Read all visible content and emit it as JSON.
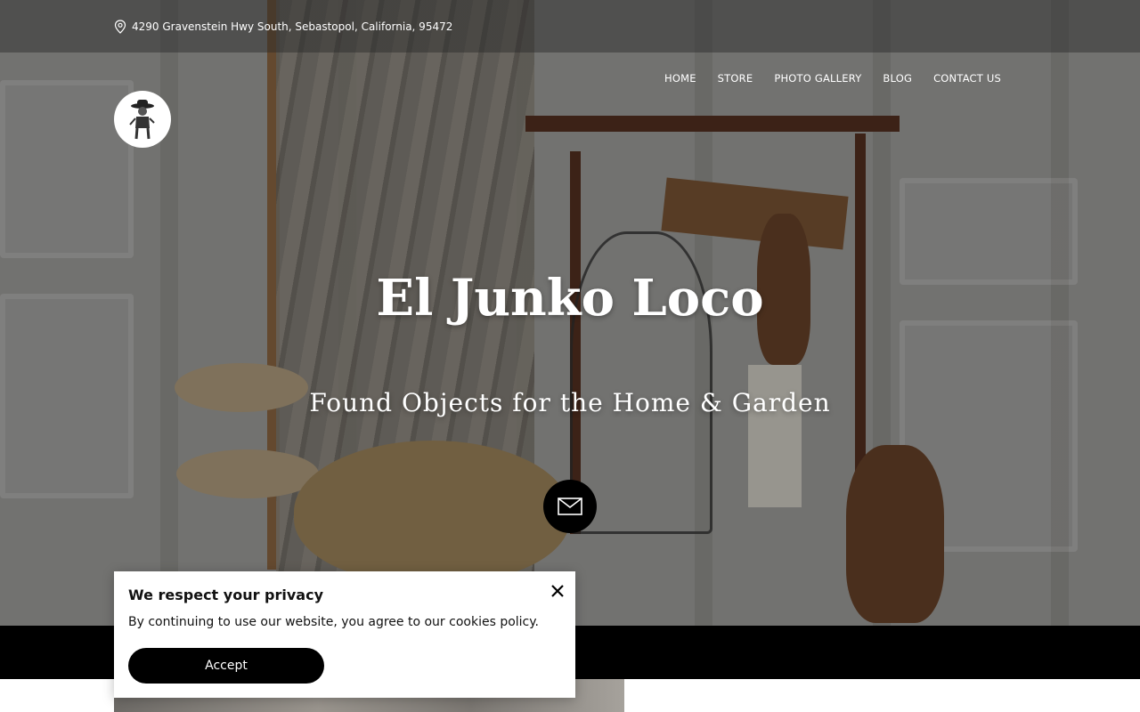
{
  "header": {
    "address": "4290 Gravenstein Hwy South, Sebastopol, California, 95472",
    "address_icon": "location-pin-icon"
  },
  "nav": {
    "items": [
      {
        "label": "HOME"
      },
      {
        "label": "STORE"
      },
      {
        "label": "PHOTO GALLERY"
      },
      {
        "label": "BLOG"
      },
      {
        "label": "CONTACT US"
      }
    ]
  },
  "hero": {
    "title": "El Junko Loco",
    "tagline": "Found Objects for the Home & Garden",
    "contact_icon": "envelope-icon"
  },
  "cookie_banner": {
    "heading": "We respect your privacy",
    "message": "By continuing to use our website, you agree to our cookies policy.",
    "accept_label": "Accept",
    "close_icon": "close-icon"
  },
  "colors": {
    "accent": "#000000",
    "text_on_hero": "#ffffff"
  }
}
